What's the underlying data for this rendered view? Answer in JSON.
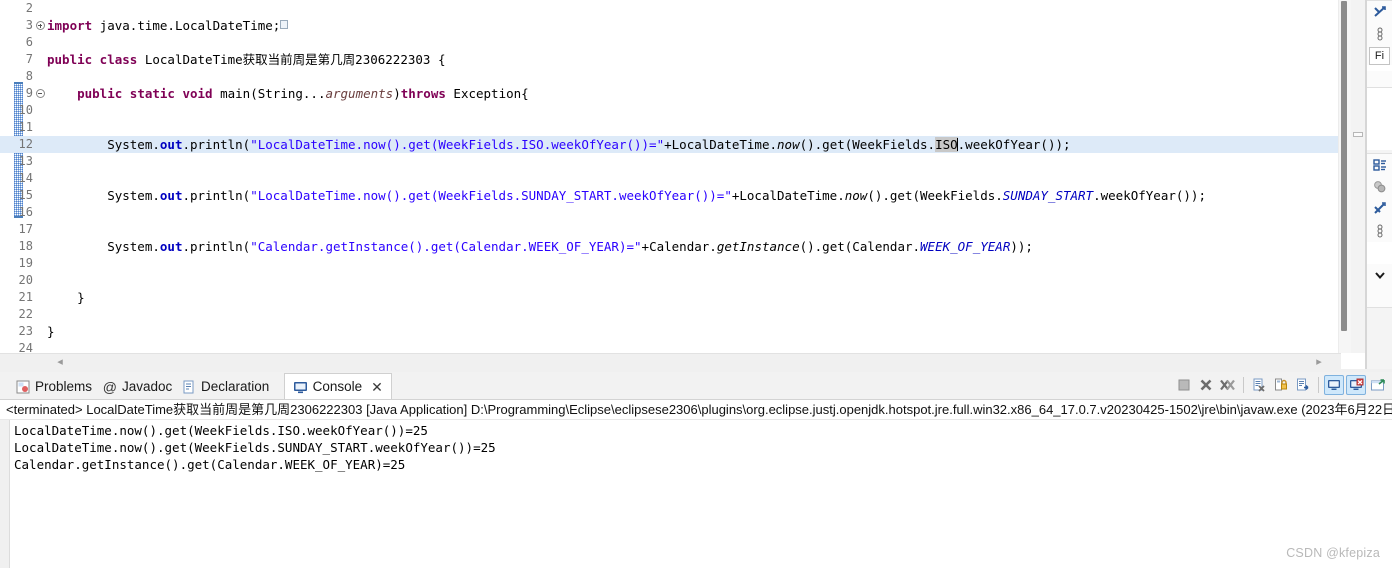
{
  "editor": {
    "lines": [
      {
        "num": "2",
        "fold": "",
        "segments": []
      },
      {
        "num": "3",
        "fold": "plus",
        "segments": [
          {
            "t": "import ",
            "c": "kw"
          },
          {
            "t": "java.time.LocalDateTime;",
            "c": "pln"
          },
          {
            "t": "EOL",
            "c": "eolmark"
          }
        ]
      },
      {
        "num": "6",
        "fold": "",
        "segments": []
      },
      {
        "num": "7",
        "fold": "",
        "segments": [
          {
            "t": "public class ",
            "c": "kw"
          },
          {
            "t": "LocalDateTime获取当前周是第几周2306222303 {",
            "c": "pln"
          }
        ]
      },
      {
        "num": "8",
        "fold": "",
        "segments": []
      },
      {
        "num": "9",
        "fold": "minus",
        "segments": [
          {
            "t": "    ",
            "c": "pln"
          },
          {
            "t": "public static void ",
            "c": "kw"
          },
          {
            "t": "main(String...",
            "c": "pln"
          },
          {
            "t": "arguments",
            "c": "par"
          },
          {
            "t": ")",
            "c": "pln"
          },
          {
            "t": "throws ",
            "c": "kw"
          },
          {
            "t": "Exception{",
            "c": "pln"
          }
        ]
      },
      {
        "num": "10",
        "fold": "",
        "segments": []
      },
      {
        "num": "11",
        "fold": "",
        "segments": []
      },
      {
        "num": "12",
        "fold": "",
        "highlight": true,
        "segments": [
          {
            "t": "        System.",
            "c": "pln"
          },
          {
            "t": "out",
            "c": "sfld"
          },
          {
            "t": ".println(",
            "c": "pln"
          },
          {
            "t": "\"LocalDateTime.now().get(WeekFields.ISO.weekOfYear())=\"",
            "c": "str"
          },
          {
            "t": "+LocalDateTime.",
            "c": "pln"
          },
          {
            "t": "now",
            "c": "mtdi"
          },
          {
            "t": "().get(WeekFields.",
            "c": "pln"
          },
          {
            "t": "ISO",
            "c": "sel"
          },
          {
            "t": "CARET",
            "c": "caret"
          },
          {
            "t": ".weekOfYear());",
            "c": "pln"
          }
        ]
      },
      {
        "num": "13",
        "fold": "",
        "segments": []
      },
      {
        "num": "14",
        "fold": "",
        "segments": []
      },
      {
        "num": "15",
        "fold": "",
        "segments": [
          {
            "t": "        System.",
            "c": "pln"
          },
          {
            "t": "out",
            "c": "sfld"
          },
          {
            "t": ".println(",
            "c": "pln"
          },
          {
            "t": "\"LocalDateTime.now().get(WeekFields.SUNDAY_START.weekOfYear())=\"",
            "c": "str"
          },
          {
            "t": "+LocalDateTime.",
            "c": "pln"
          },
          {
            "t": "now",
            "c": "mtdi"
          },
          {
            "t": "().get(WeekFields.",
            "c": "pln"
          },
          {
            "t": "SUNDAY_START",
            "c": "fldi"
          },
          {
            "t": ".weekOfYear());",
            "c": "pln"
          }
        ]
      },
      {
        "num": "16",
        "fold": "",
        "segments": []
      },
      {
        "num": "17",
        "fold": "",
        "segments": []
      },
      {
        "num": "18",
        "fold": "",
        "segments": [
          {
            "t": "        System.",
            "c": "pln"
          },
          {
            "t": "out",
            "c": "sfld"
          },
          {
            "t": ".println(",
            "c": "pln"
          },
          {
            "t": "\"Calendar.getInstance().get(Calendar.WEEK_OF_YEAR)=\"",
            "c": "str"
          },
          {
            "t": "+Calendar.",
            "c": "pln"
          },
          {
            "t": "getInstance",
            "c": "mtdi"
          },
          {
            "t": "().get(Calendar.",
            "c": "pln"
          },
          {
            "t": "WEEK_OF_YEAR",
            "c": "fldi"
          },
          {
            "t": "));",
            "c": "pln"
          }
        ]
      },
      {
        "num": "19",
        "fold": "",
        "segments": []
      },
      {
        "num": "20",
        "fold": "",
        "segments": []
      },
      {
        "num": "21",
        "fold": "",
        "segments": [
          {
            "t": "    }",
            "c": "pln"
          }
        ]
      },
      {
        "num": "22",
        "fold": "",
        "segments": []
      },
      {
        "num": "23",
        "fold": "",
        "segments": [
          {
            "t": "}",
            "c": "pln"
          }
        ]
      },
      {
        "num": "24",
        "fold": "",
        "segments": []
      }
    ],
    "hscroll": {
      "left_arrow": "◂",
      "right_arrow": "▸"
    }
  },
  "right_dock": {
    "top_group": {
      "label": "Fi",
      "icons": [
        "collapse-all-icon",
        "view-menu-icon"
      ]
    },
    "bottom_group": {
      "icons": [
        "outline-icon",
        "filter-icon",
        "hide-fields-icon",
        "view-menu-icon",
        "chevron-down-icon"
      ]
    }
  },
  "bottom_panel": {
    "tabs": [
      {
        "label": "Problems",
        "icon": "problems-icon",
        "active": false,
        "closable": false
      },
      {
        "label": "Javadoc",
        "icon": "javadoc-icon",
        "active": false,
        "closable": false
      },
      {
        "label": "Declaration",
        "icon": "declaration-icon",
        "active": false,
        "closable": false
      },
      {
        "label": "Console",
        "icon": "console-icon",
        "active": true,
        "closable": true,
        "close": "✕"
      }
    ],
    "toolbar": [
      {
        "name": "terminate-button",
        "glyph": "■",
        "boxed": false
      },
      {
        "name": "remove-launch-button",
        "glyph": "✖",
        "boxed": false
      },
      {
        "name": "remove-all-launches-button",
        "glyph": "✖",
        "boxed": false
      },
      {
        "name": "clear-console-button",
        "glyph": "❐",
        "boxed": false
      },
      {
        "name": "scroll-lock-button",
        "glyph": "ὑ2",
        "boxed": false
      },
      {
        "name": "word-wrap-button",
        "glyph": "↵",
        "boxed": false
      },
      {
        "name": "show-console-on-output-button",
        "glyph": "▭",
        "boxed": true
      },
      {
        "name": "pin-console-button",
        "glyph": "▭",
        "boxed": true
      },
      {
        "name": "open-console-button",
        "glyph": "▭",
        "boxed": false
      }
    ],
    "launch_header": "<terminated> LocalDateTime获取当前周是第几周2306222303 [Java Application] D:\\Programming\\Eclipse\\eclipsese2306\\plugins\\org.eclipse.justj.openjdk.hotspot.jre.full.win32.x86_64_17.0.7.v20230425-1502\\jre\\bin\\javaw.exe  (2023年6月22日",
    "output": [
      "LocalDateTime.now().get(WeekFields.ISO.weekOfYear())=25",
      "LocalDateTime.now().get(WeekFields.SUNDAY_START.weekOfYear())=25",
      "Calendar.getInstance().get(Calendar.WEEK_OF_YEAR)=25"
    ]
  },
  "watermark": "CSDN @kfepiza",
  "colors": {
    "keyword": "#7f0055",
    "string": "#2a00ff",
    "field": "#0000c0",
    "parameter": "#6a3e3e",
    "selection": "#c8c8c8",
    "line_highlight": "#ddeaf8",
    "accent": "#4a7ebb"
  }
}
